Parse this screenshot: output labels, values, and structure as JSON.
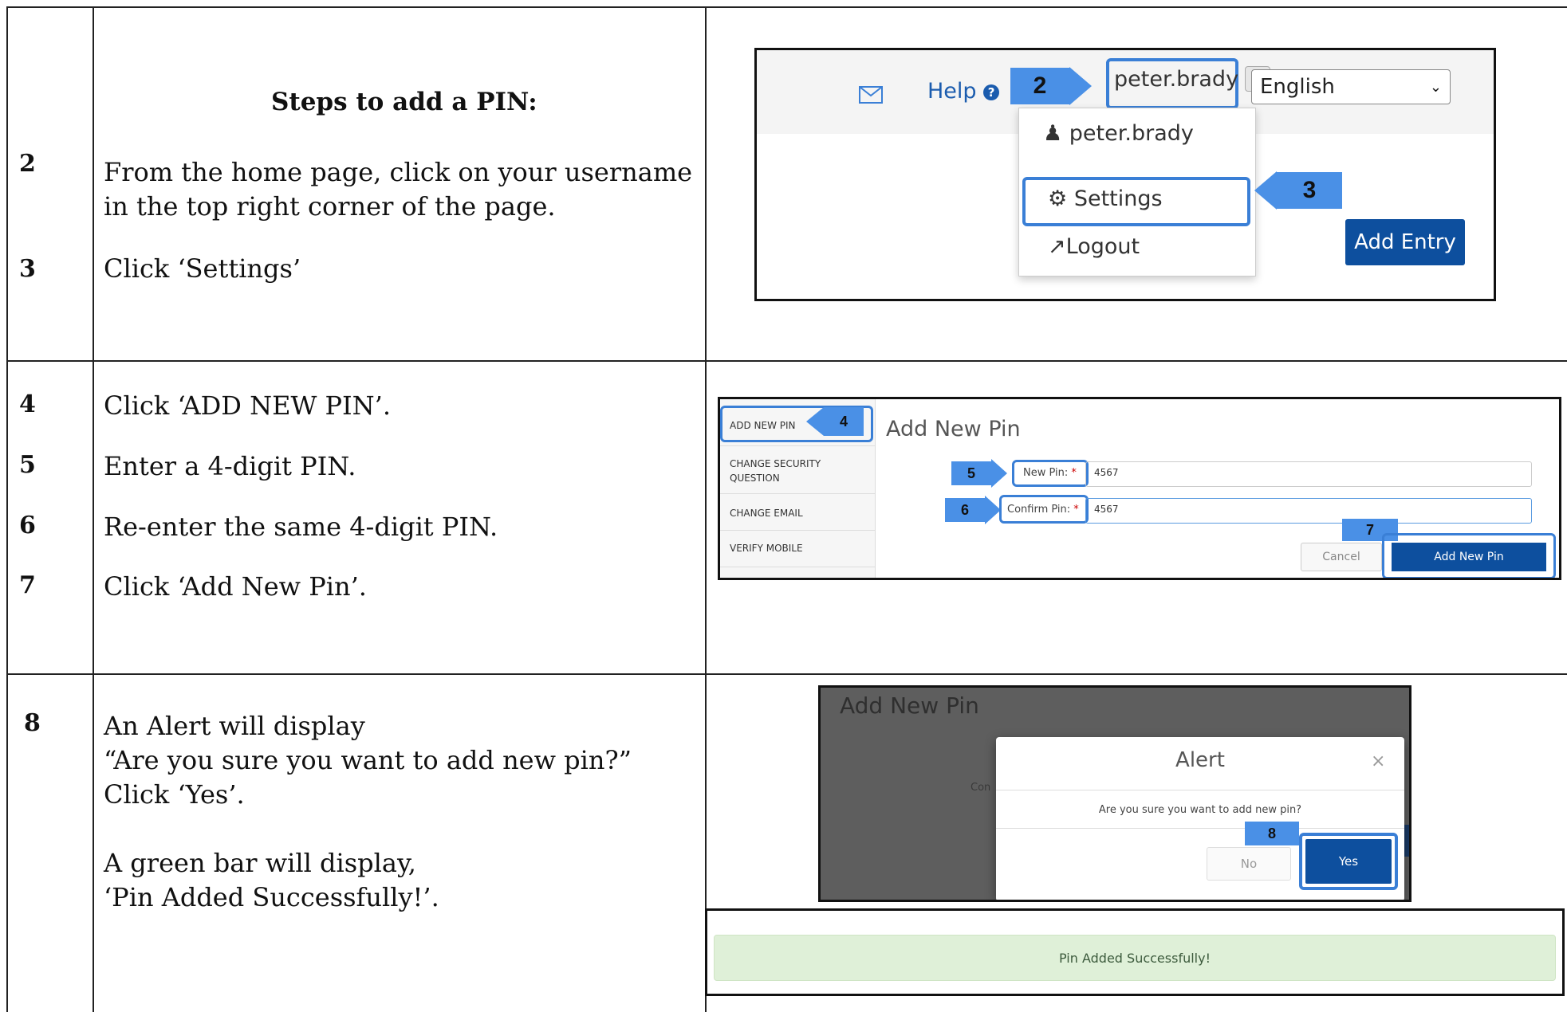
{
  "heading": "Steps to add a PIN:",
  "steps": [
    {
      "num": "2",
      "text": "From the home page, click on your username in the top right corner of the page."
    },
    {
      "num": "3",
      "text": "Click ‘Settings’"
    },
    {
      "num": "4",
      "text": "Click ‘ADD NEW PIN’."
    },
    {
      "num": "5",
      "text": "Enter a 4-digit PIN."
    },
    {
      "num": "6",
      "text": "Re-enter the same 4-digit PIN."
    },
    {
      "num": "7",
      "text": "Click ‘Add New Pin’."
    },
    {
      "num": "8",
      "line1": "An Alert will display",
      "line2": "“Are you sure you want to add new pin?”",
      "line3": "Click ‘Yes’.",
      "line4": "A green bar will display,",
      "line5": "‘Pin Added Successfully!’."
    }
  ],
  "shot1": {
    "help": "Help",
    "username": "peter.brady",
    "language": "English",
    "menu_user": "peter.brady",
    "menu_settings": "Settings",
    "menu_logout": "Logout",
    "add_entry": "Add Entry",
    "callout_a": "2",
    "callout_b": "3",
    "icons": {
      "mail": "envelope-icon",
      "help": "question-circle-icon",
      "user": "user-icon",
      "settings": "gears-icon",
      "logout": "share-icon",
      "dropdown": "chevron-down-icon"
    }
  },
  "shot2": {
    "menu": [
      "ADD NEW PIN",
      "CHANGE SECURITY QUESTION",
      "CHANGE EMAIL",
      "VERIFY MOBILE"
    ],
    "title": "Add New Pin",
    "new_pin_label": "New Pin:",
    "confirm_pin_label": "Confirm Pin:",
    "required_mark": "*",
    "new_pin_value": "4567",
    "confirm_pin_value": "4567",
    "cancel": "Cancel",
    "submit": "Add New Pin",
    "callouts": [
      "4",
      "5",
      "6",
      "7"
    ]
  },
  "shot3": {
    "bg_title": "Add New Pin",
    "bg_label_fragment": "Con",
    "alert_title": "Alert",
    "close": "×",
    "message": "Are you sure you want to add new pin?",
    "no": "No",
    "yes": "Yes",
    "callout": "8",
    "success": "Pin Added Successfully!"
  },
  "colors": {
    "callout": "#4a90e6",
    "primary": "#0d4f9e",
    "success_bg": "#dff0d8"
  }
}
